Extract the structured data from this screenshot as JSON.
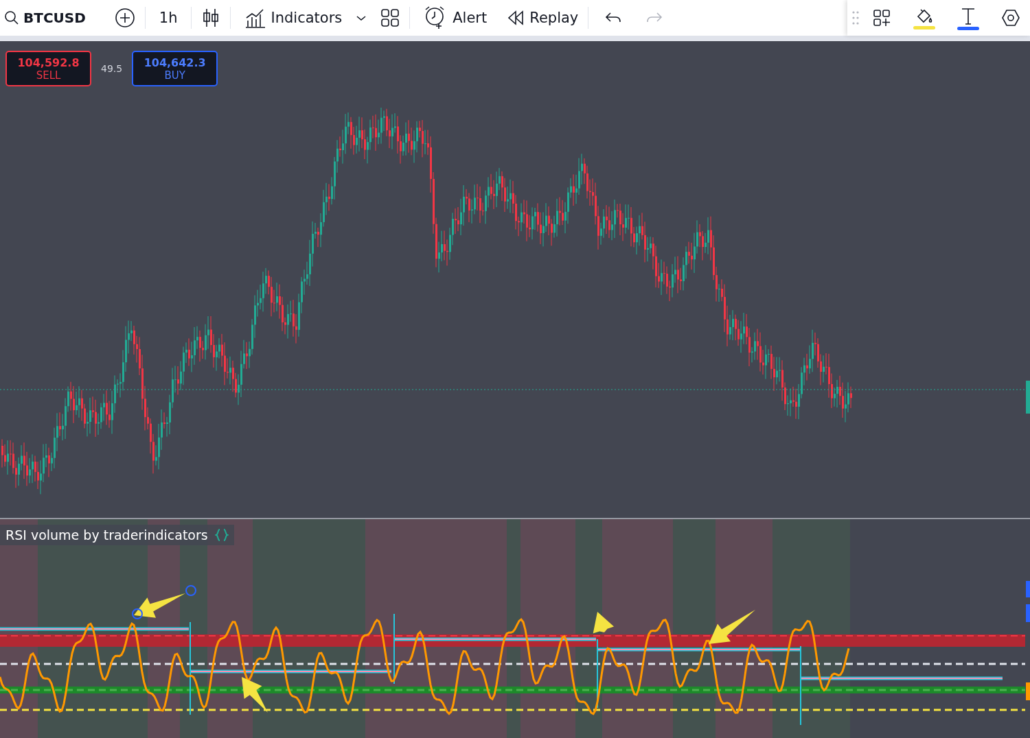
{
  "toolbar": {
    "symbol": "BTCUSD",
    "interval": "1h",
    "indicators_label": "Indicators",
    "alert_label": "Alert",
    "replay_label": "Replay",
    "right_tools": [
      {
        "kind": "widgets"
      },
      {
        "kind": "brush",
        "color": "#f5e342"
      },
      {
        "kind": "text",
        "color": "#2962ff"
      },
      {
        "kind": "settings"
      }
    ]
  },
  "quotes": [
    {
      "kind": "sell",
      "price": "104,592.8",
      "label": "SELL"
    },
    {
      "kind": "buy",
      "price": "104,642.3",
      "label": "BUY"
    }
  ],
  "spread": "49.5",
  "indicator_pane": {
    "title": "RSI volume by traderindicators"
  }
}
